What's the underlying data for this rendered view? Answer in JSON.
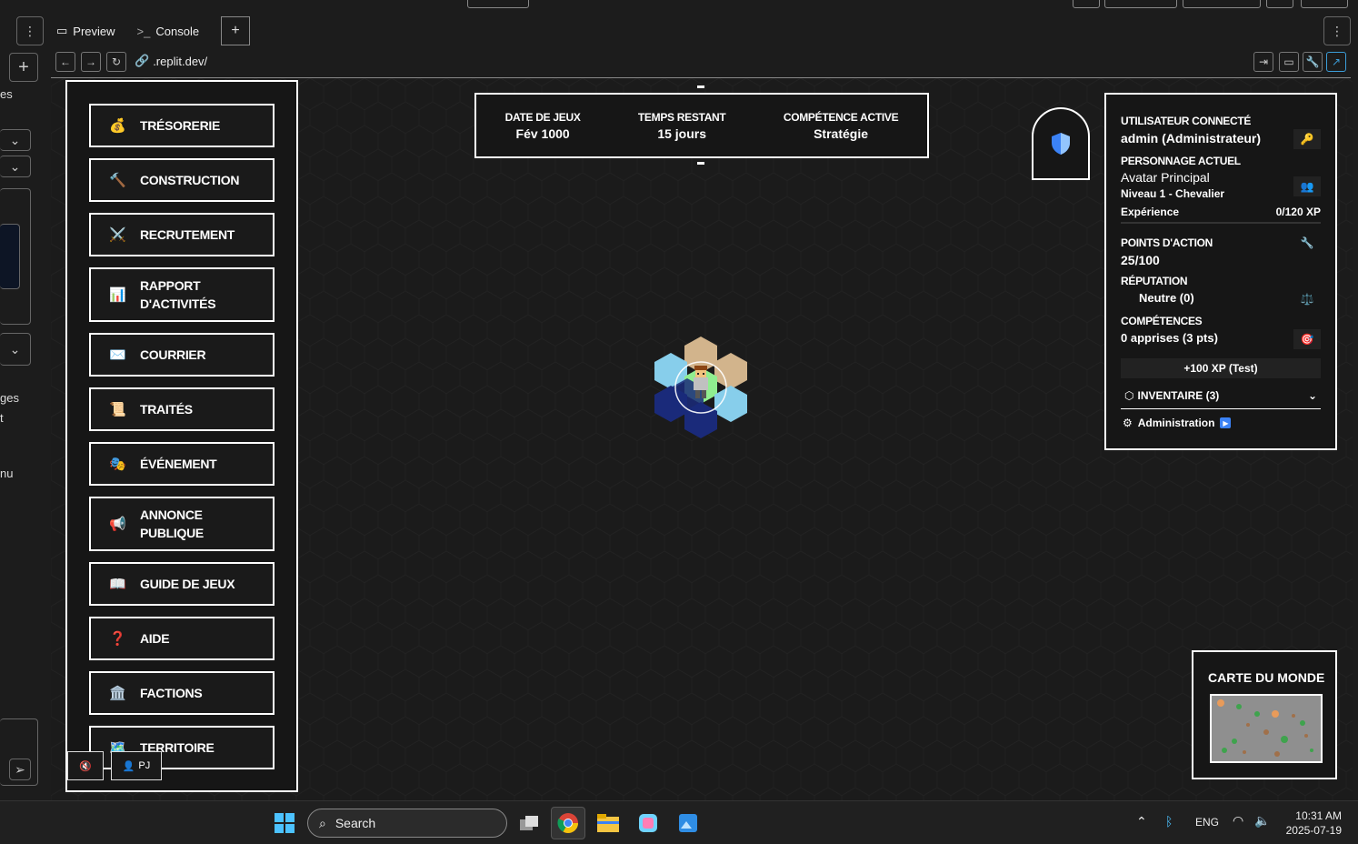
{
  "ide": {
    "tabs": [
      {
        "label": "Preview",
        "icon": "monitor-icon"
      },
      {
        "label": "Console",
        "icon": "terminal-icon"
      }
    ],
    "url": ".replit.dev/",
    "left_fragments": [
      "es",
      "ges",
      "t",
      "nu"
    ]
  },
  "menu": {
    "items": [
      {
        "label": "TRÉSORERIE",
        "icon": "💰"
      },
      {
        "label": "CONSTRUCTION",
        "icon": "🔨"
      },
      {
        "label": "RECRUTEMENT",
        "icon": "⚔️"
      },
      {
        "label_lines": [
          "RAPPORT",
          "D'ACTIVITÉS"
        ],
        "icon": "📊"
      },
      {
        "label": "COURRIER",
        "icon": "✉️"
      },
      {
        "label": "TRAITÉS",
        "icon": "📜"
      },
      {
        "label": "ÉVÉNEMENT",
        "icon": "🎭"
      },
      {
        "label_lines": [
          "ANNONCE",
          "PUBLIQUE"
        ],
        "icon": "📢"
      },
      {
        "label": "GUIDE DE JEUX",
        "icon": "📖"
      },
      {
        "label": "AIDE",
        "icon": "❓"
      },
      {
        "label": "FACTIONS",
        "icon": "🏛️"
      },
      {
        "label": "TERRITOIRE",
        "icon": "🗺️"
      }
    ],
    "pj_label": "PJ"
  },
  "stats": {
    "date_label": "DATE DE JEUX",
    "date_value": "Fév 1000",
    "time_label": "TEMPS RESTANT",
    "time_value": "15 jours",
    "skill_label": "COMPÉTENCE ACTIVE",
    "skill_value": "Stratégie"
  },
  "panel": {
    "user_label": "UTILISATEUR CONNECTÉ",
    "user_value": "admin (Administrateur)",
    "char_label": "PERSONNAGE ACTUEL",
    "char_name": "Avatar Principal",
    "char_level": "Niveau 1 - Chevalier",
    "xp_label": "Expérience",
    "xp_value": "0/120 XP",
    "ap_label": "POINTS D'ACTION",
    "ap_value": "25/100",
    "rep_label": "RÉPUTATION",
    "rep_value": "Neutre (0)",
    "skills_label": "COMPÉTENCES",
    "skills_value": "0 apprises (3 pts)",
    "xp_button": "+100 XP (Test)",
    "inventory": "INVENTAIRE (3)",
    "admin": "Administration"
  },
  "minimap": {
    "title": "CARTE DU MONDE"
  },
  "taskbar": {
    "search": "Search",
    "lang": "ENG",
    "time": "10:31 AM",
    "date": "2025-07-19"
  },
  "colors": {
    "background": "#1c1c1c",
    "border": "#ffffff",
    "hex_sand": "#d2b48c",
    "hex_light_blue": "#87ceeb",
    "hex_navy": "#1a2a7a",
    "hex_green": "#90ee90",
    "accent_blue": "#3b82f6"
  }
}
